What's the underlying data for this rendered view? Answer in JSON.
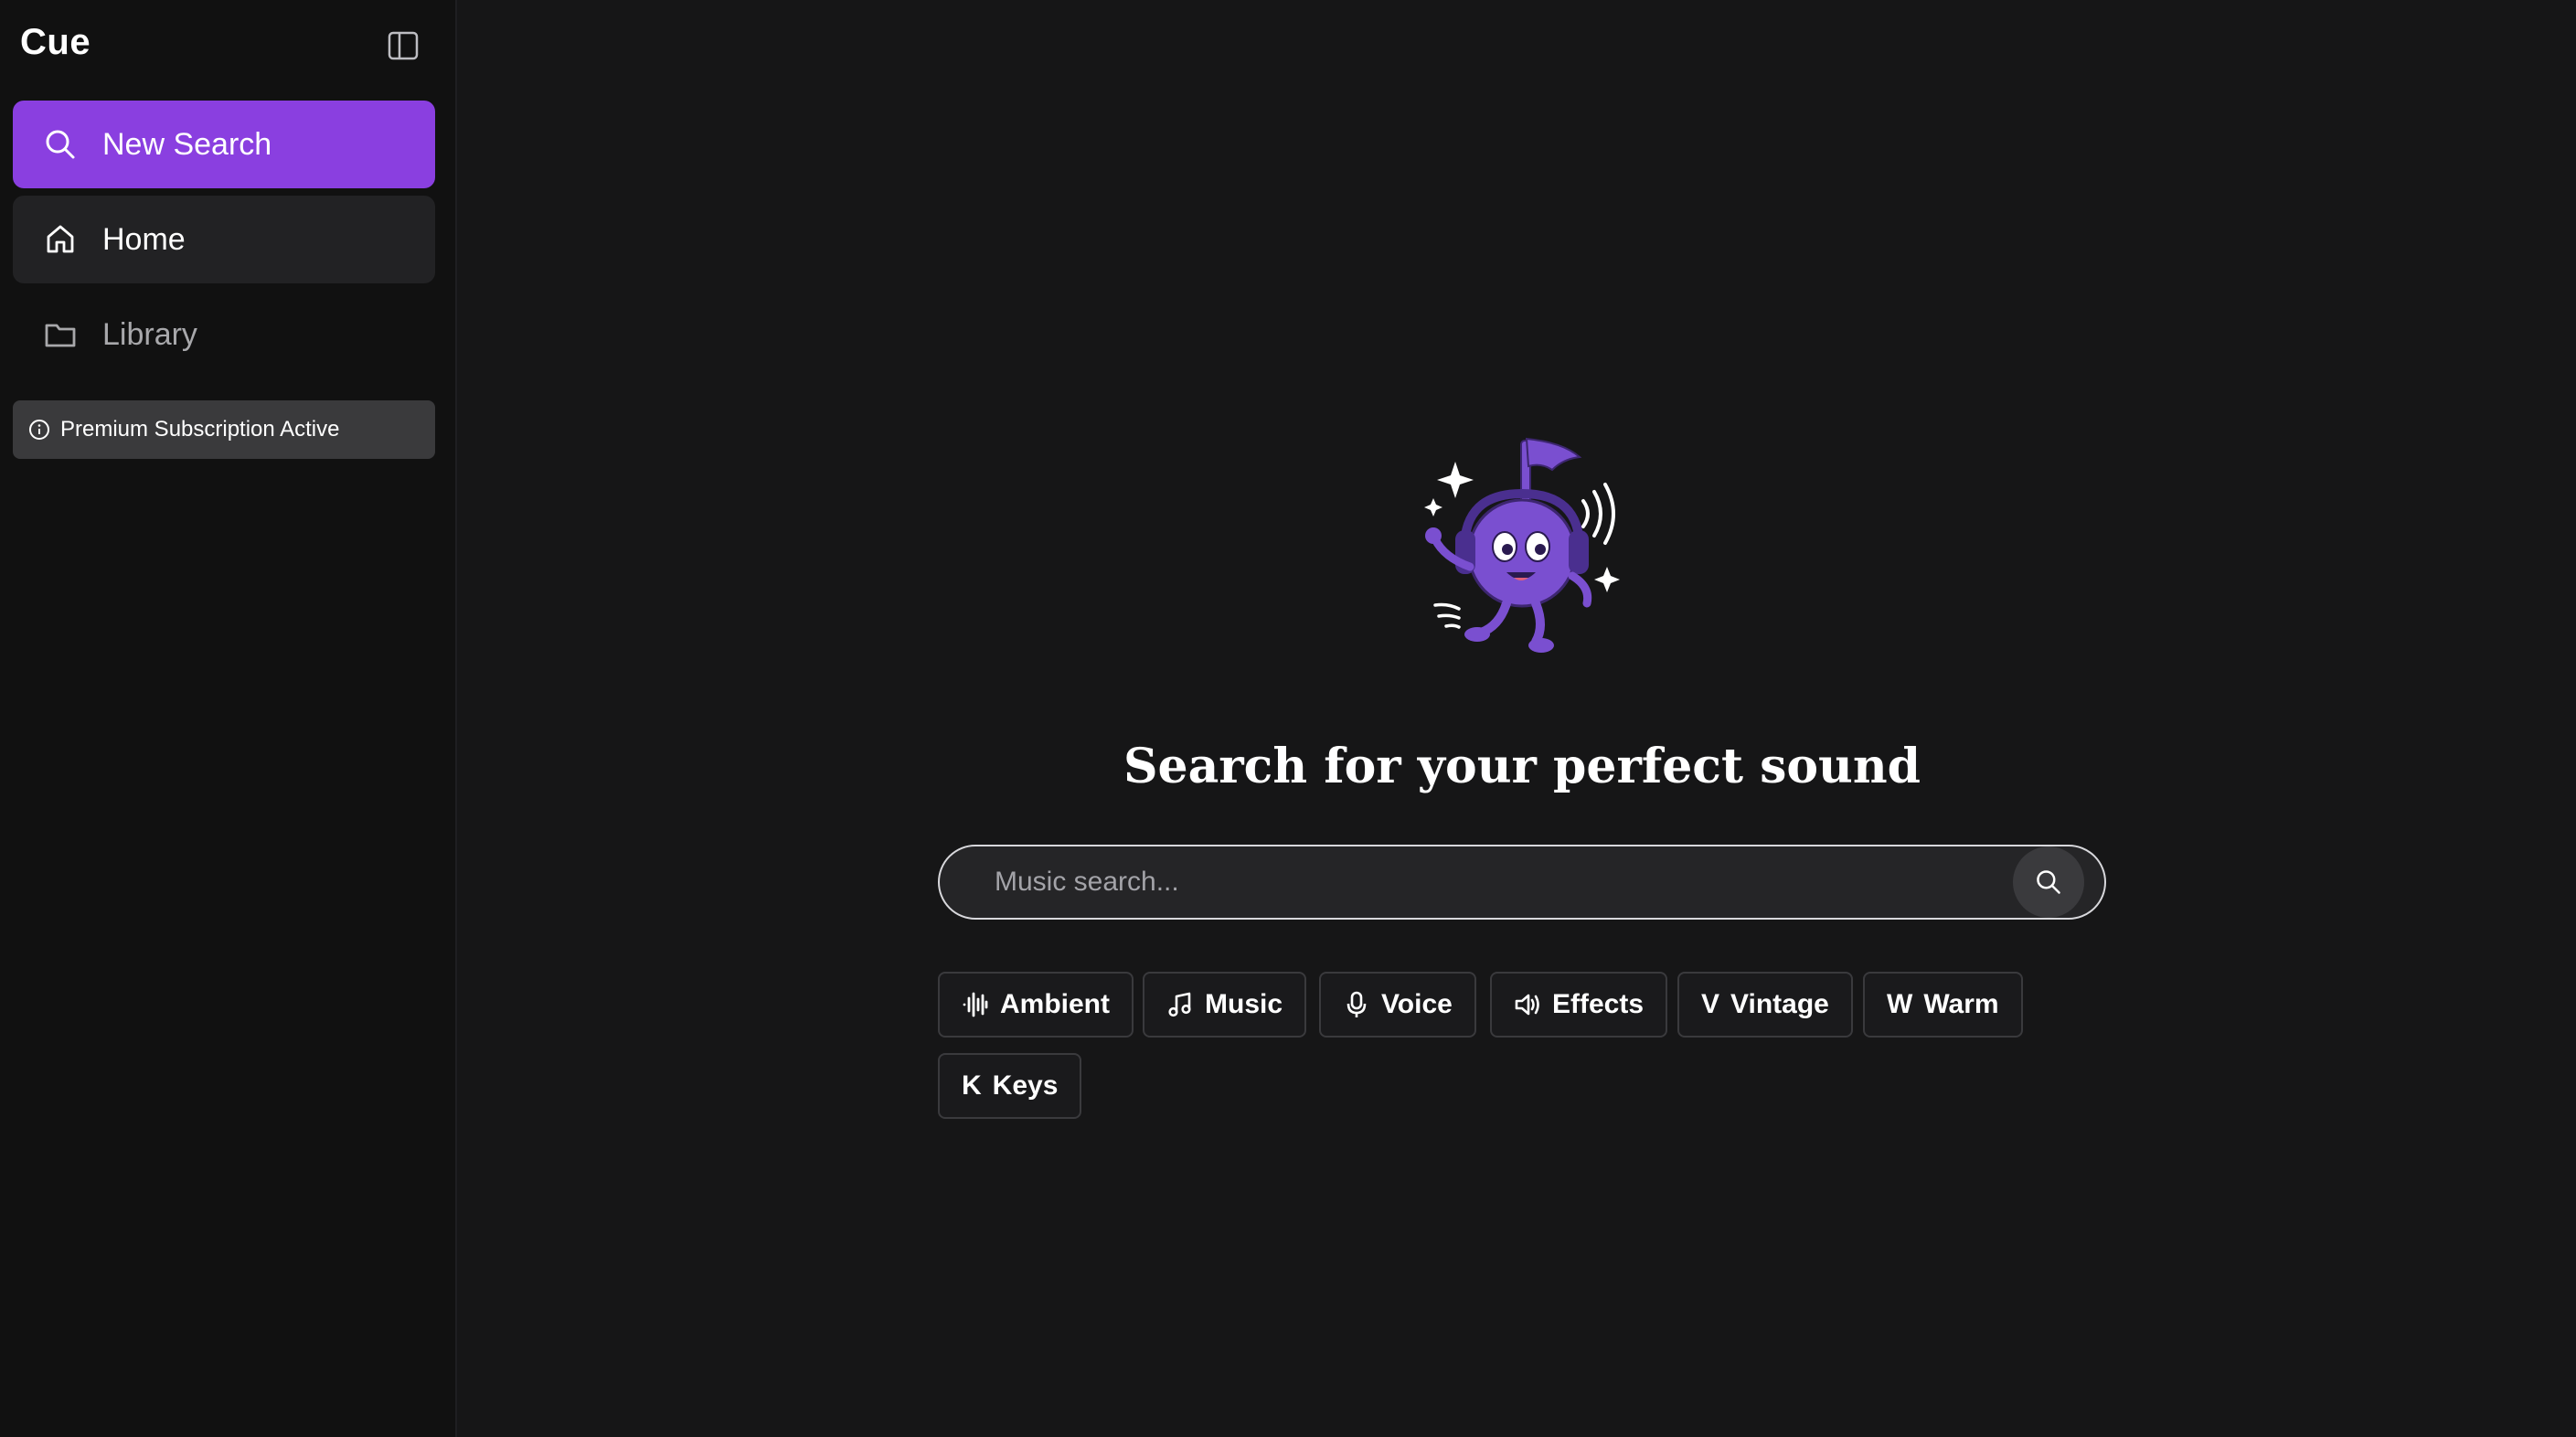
{
  "app": {
    "title": "Cue"
  },
  "sidebar": {
    "items": [
      {
        "label": "New Search",
        "icon": "search-icon"
      },
      {
        "label": "Home",
        "icon": "home-icon"
      },
      {
        "label": "Library",
        "icon": "folder-icon"
      }
    ],
    "premium_label": "Premium Subscription Active"
  },
  "main": {
    "headline": "Search for your perfect sound",
    "search": {
      "placeholder": "Music search...",
      "value": ""
    },
    "chips": [
      {
        "label": "Ambient",
        "icon": "waveform-icon"
      },
      {
        "label": "Music",
        "icon": "music-note-icon"
      },
      {
        "label": "Voice",
        "icon": "microphone-icon"
      },
      {
        "label": "Effects",
        "icon": "speaker-icon"
      },
      {
        "label": "Vintage",
        "letter": "V"
      },
      {
        "label": "Warm",
        "letter": "W"
      },
      {
        "label": "Keys",
        "letter": "K"
      }
    ]
  },
  "colors": {
    "accent": "#8a3fe0",
    "background": "#161617",
    "sidebar": "#111111",
    "mascot": "#7a4fd0"
  }
}
